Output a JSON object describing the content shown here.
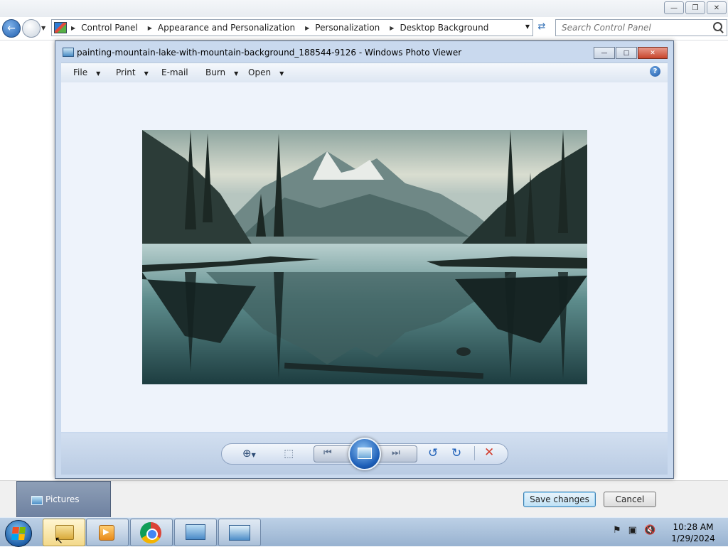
{
  "explorer": {
    "breadcrumbs": [
      "Control Panel",
      "Appearance and Personalization",
      "Personalization",
      "Desktop Background"
    ],
    "search_placeholder": "Search Control Panel",
    "folder_tile": "Pictures",
    "save_label": "Save changes",
    "cancel_label": "Cancel"
  },
  "photo_viewer": {
    "title": "painting-mountain-lake-with-mountain-background_188544-9126 - Windows Photo Viewer",
    "menu": [
      "File",
      "Print",
      "E-mail",
      "Burn",
      "Open"
    ],
    "help": "?"
  },
  "taskbar": {
    "time": "10:28 AM",
    "date": "1/29/2024"
  },
  "colors": {
    "accent": "#1d5fb8",
    "delete": "#d23b2b"
  }
}
